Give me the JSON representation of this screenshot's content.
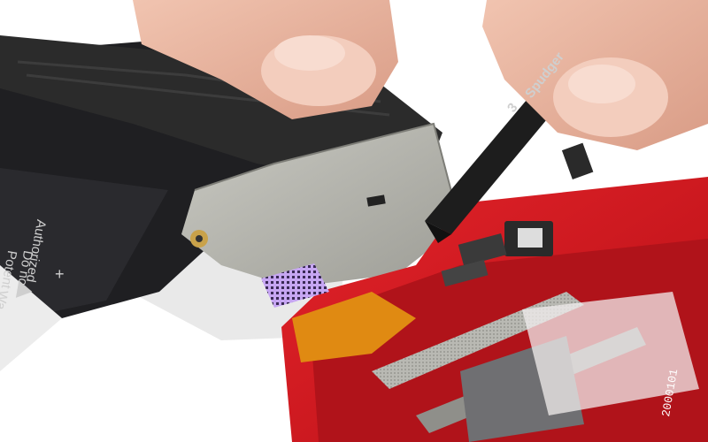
{
  "scene": {
    "description_tag": "photo",
    "colors": {
      "background": "#ffffff",
      "case_red": "#d5151c",
      "case_red_dark": "#9e0c12",
      "board_silver": "#b3b3ad",
      "ribbon_black": "#2b2b2b",
      "battery_black": "#1f1f22",
      "skin": "#e9b5a0",
      "lilac_label": "#c6a6f2",
      "flex_orange": "#e08a12"
    }
  },
  "battery": {
    "lines": [
      "Do no",
      "Potent",
      "Authorized",
      "Wa"
    ],
    "plus_sign": "+",
    "warning_icon": "warning-triangle-icon"
  },
  "spudger": {
    "number": "3",
    "brand": "Spudger"
  },
  "case": {
    "serial": "2000101"
  }
}
